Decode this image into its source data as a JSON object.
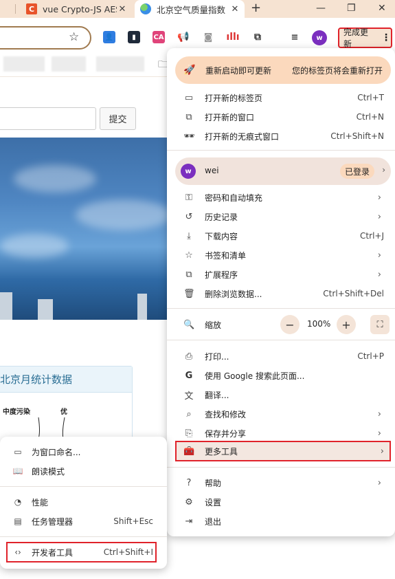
{
  "tabs": [
    {
      "title": "vue Crypto-JS AES",
      "icon": "c-favicon"
    },
    {
      "title": "北京空气质量指数",
      "icon": "globe-favicon"
    }
  ],
  "window": {
    "new_tab": "+",
    "minimize": "—",
    "restore": "❐",
    "close": "✕"
  },
  "toolbar": {
    "update_label": "完成更新",
    "more": "⋮",
    "profile_initial": "w"
  },
  "page": {
    "submit_label": "提交",
    "stats_title": "北京月统计数据",
    "chart_label_moderate": "中度污染",
    "chart_label_good": "优"
  },
  "menu": {
    "banner": {
      "label": "重新启动即可更新",
      "note": "您的标签页将会重新打开"
    },
    "new_tab": {
      "label": "打开新的标签页",
      "shortcut": "Ctrl+T"
    },
    "new_window": {
      "label": "打开新的窗口",
      "shortcut": "Ctrl+N"
    },
    "incognito": {
      "label": "打开新的无痕式窗口",
      "shortcut": "Ctrl+Shift+N"
    },
    "profile": {
      "name": "wei",
      "initial": "w",
      "status": "已登录"
    },
    "passwords": {
      "label": "密码和自动填充"
    },
    "history": {
      "label": "历史记录"
    },
    "downloads": {
      "label": "下载内容",
      "shortcut": "Ctrl+J"
    },
    "bookmarks": {
      "label": "书签和清单"
    },
    "extensions": {
      "label": "扩展程序"
    },
    "clear_data": {
      "label": "删除浏览数据...",
      "shortcut": "Ctrl+Shift+Del"
    },
    "zoom": {
      "label": "缩放",
      "value": "100%"
    },
    "print": {
      "label": "打印...",
      "shortcut": "Ctrl+P"
    },
    "google_search": {
      "label": "使用 Google 搜索此页面..."
    },
    "translate": {
      "label": "翻译..."
    },
    "find_edit": {
      "label": "查找和修改"
    },
    "save_share": {
      "label": "保存并分享"
    },
    "more_tools": {
      "label": "更多工具"
    },
    "help": {
      "label": "帮助"
    },
    "settings": {
      "label": "设置"
    },
    "exit": {
      "label": "退出"
    }
  },
  "submenu": {
    "name_window": {
      "label": "为窗口命名..."
    },
    "reading_mode": {
      "label": "朗读模式"
    },
    "performance": {
      "label": "性能"
    },
    "task_manager": {
      "label": "任务管理器",
      "shortcut": "Shift+Esc"
    },
    "devtools": {
      "label": "开发者工具",
      "shortcut": "Ctrl+Shift+I"
    }
  },
  "colors": {
    "highlight_red": "#e0222a",
    "tabstrip": "#f6e3d2",
    "banner": "#fbd9bd",
    "avatar": "#7b2fbf"
  }
}
